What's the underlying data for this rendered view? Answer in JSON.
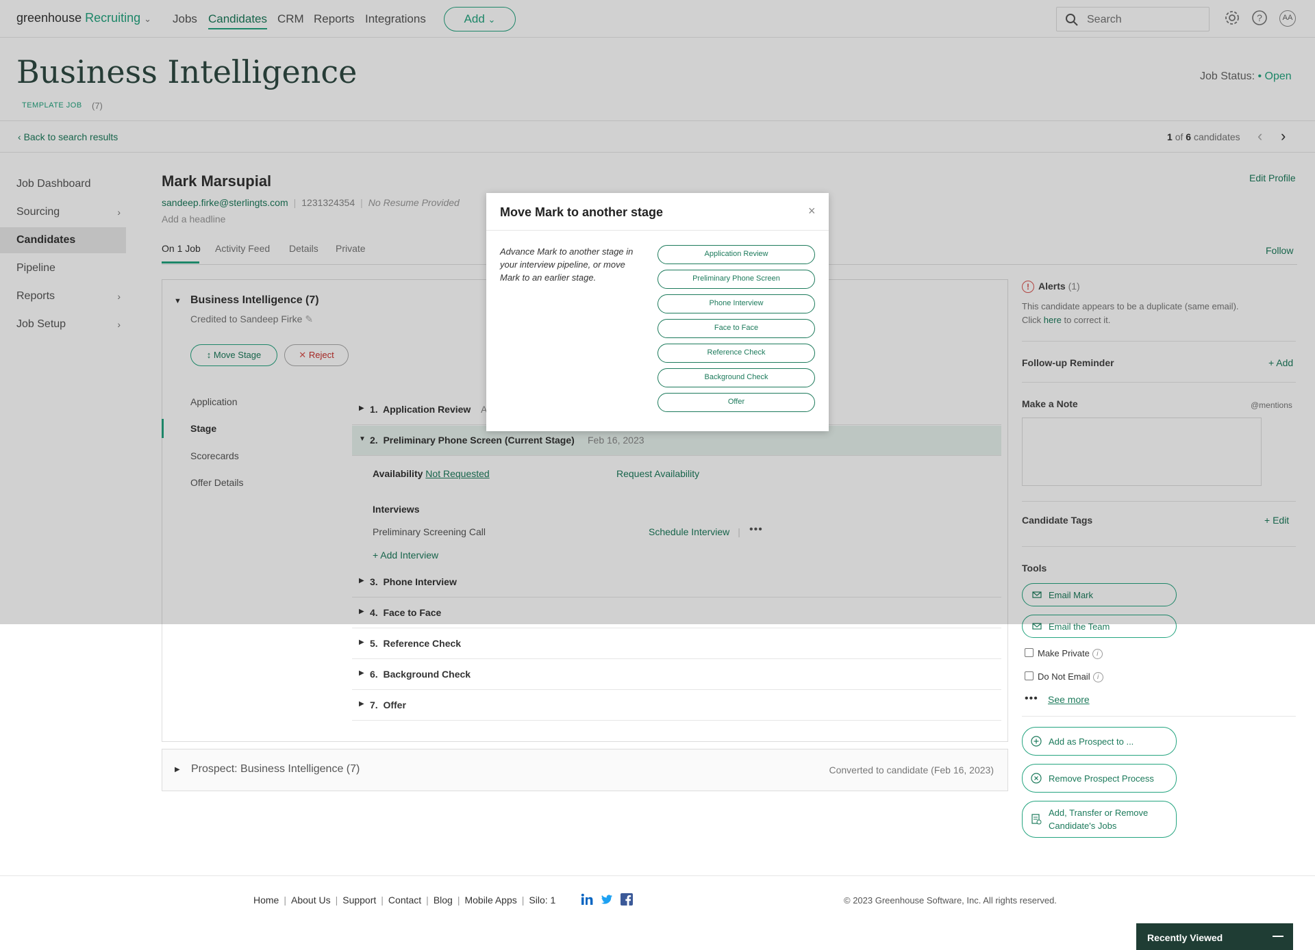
{
  "header": {
    "logo_main": "greenhouse",
    "logo_sub": "Recruiting",
    "nav": [
      "Jobs",
      "Candidates",
      "CRM",
      "Reports",
      "Integrations"
    ],
    "add_label": "Add",
    "search_placeholder": "Search",
    "avatar": "AA"
  },
  "job": {
    "title": "Business Intelligence",
    "template_label": "TEMPLATE JOB",
    "template_count": "(7)",
    "status_label": "Job Status:",
    "status_value": "Open",
    "back_link": "Back to search results",
    "pager_current": "1",
    "pager_of": "of",
    "pager_total": "6",
    "pager_suffix": "candidates"
  },
  "left_nav": {
    "items": [
      "Job Dashboard",
      "Sourcing",
      "Candidates",
      "Pipeline",
      "Reports",
      "Job Setup"
    ]
  },
  "candidate": {
    "name": "Mark Marsupial",
    "email": "sandeep.firke@sterlingts.com",
    "phone": "1231324354",
    "resume": "No Resume Provided",
    "headline": "Add a headline",
    "edit_profile": "Edit Profile",
    "tabs": [
      "On 1 Job",
      "Activity Feed",
      "Details",
      "Private"
    ],
    "follow": "Follow"
  },
  "job_panel": {
    "title": "Business Intelligence (7)",
    "credit": "Credited to Sandeep Firke",
    "move_stage": "Move Stage",
    "reject": "Reject",
    "subnav": [
      "Application",
      "Stage",
      "Scorecards",
      "Offer Details"
    ],
    "stages": [
      {
        "num": "1.",
        "name": "Application Review",
        "extra": "A"
      },
      {
        "num": "2.",
        "name": "Preliminary Phone Screen (Current Stage)",
        "date": "Feb 16, 2023"
      },
      {
        "num": "3.",
        "name": "Phone Interview"
      },
      {
        "num": "4.",
        "name": "Face to Face"
      },
      {
        "num": "5.",
        "name": "Reference Check"
      },
      {
        "num": "6.",
        "name": "Background Check"
      },
      {
        "num": "7.",
        "name": "Offer"
      }
    ],
    "availability_label": "Availability",
    "availability_value": "Not Requested",
    "request_availability": "Request Availability",
    "interviews_label": "Interviews",
    "interview_name": "Preliminary Screening Call",
    "schedule_interview": "Schedule Interview",
    "add_interview": "+ Add Interview"
  },
  "prospect": {
    "label": "Prospect: Business Intelligence (7)",
    "converted": "Converted to candidate (Feb 16, 2023)"
  },
  "right": {
    "alerts_label": "Alerts",
    "alerts_count": "(1)",
    "alert_text_1": "This candidate appears to be a duplicate (same email).",
    "alert_click": "Click",
    "alert_here": "here",
    "alert_text_2": "to correct it.",
    "followup_label": "Follow-up Reminder",
    "followup_add": "+ Add",
    "note_label": "Make a Note",
    "note_mentions": "@mentions",
    "tags_label": "Candidate Tags",
    "tags_edit": "+ Edit",
    "tools_label": "Tools",
    "email_mark": "Email Mark",
    "email_team": "Email the Team",
    "make_private": "Make Private",
    "do_not_email": "Do Not Email",
    "see_more": "See more",
    "add_prospect": "Add as Prospect to ...",
    "remove_prospect": "Remove Prospect Process",
    "transfer_1": "Add, Transfer or Remove",
    "transfer_2": "Candidate's Jobs"
  },
  "footer": {
    "links": [
      "Home",
      "About Us",
      "Support",
      "Contact",
      "Blog",
      "Mobile Apps",
      "Silo: 1"
    ],
    "copyright": "© 2023 Greenhouse Software, Inc. All rights reserved.",
    "recently_viewed": "Recently Viewed"
  },
  "modal": {
    "title": "Move Mark to another stage",
    "close": "×",
    "description": "Advance Mark to another stage in your interview pipeline, or move Mark to an earlier stage.",
    "stages": [
      "Application Review",
      "Preliminary Phone Screen",
      "Phone Interview",
      "Face to Face",
      "Reference Check",
      "Background Check",
      "Offer"
    ]
  },
  "icons": [
    "search-icon",
    "gear-icon",
    "help-icon",
    "chevron-down-icon",
    "chevron-left-icon",
    "chevron-right-icon",
    "pencil-icon",
    "alert-icon",
    "mail-icon",
    "plus-circle-icon",
    "x-circle-icon",
    "jobs-icon",
    "linkedin-icon",
    "twitter-icon",
    "facebook-icon"
  ],
  "colors": {
    "accent": "#24a47f",
    "accent_dark": "#1c7a5b",
    "reject": "#d9534f",
    "recently_bg": "#1f3d34"
  }
}
